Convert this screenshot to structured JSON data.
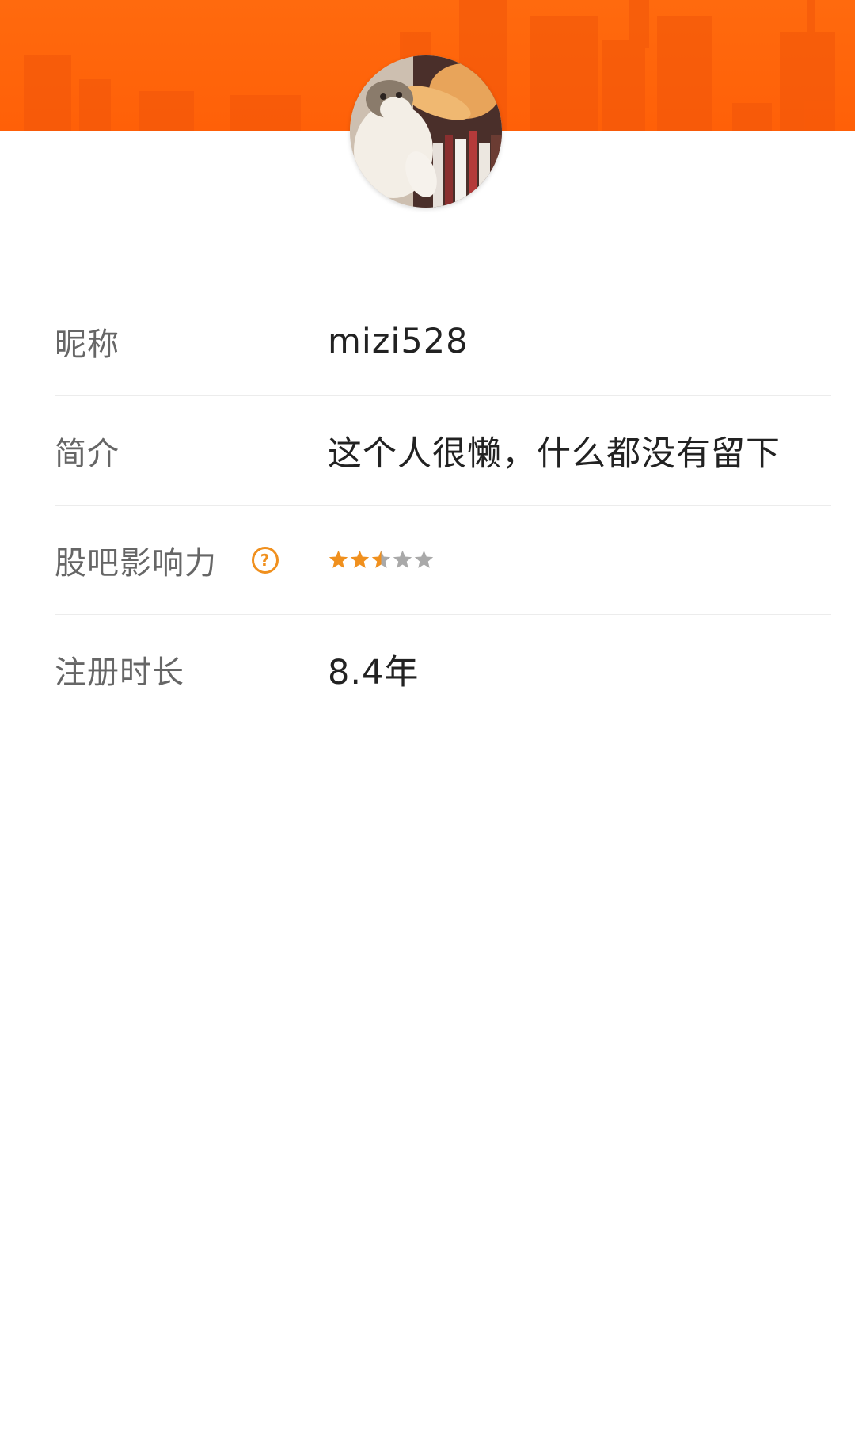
{
  "profile": {
    "rows": [
      {
        "label": "昵称",
        "value": "mizi528"
      },
      {
        "label": "简介",
        "value": "这个人很懒，什么都没有留下"
      },
      {
        "label": "股吧影响力",
        "help_icon": "question-circle-icon",
        "rating": 2.5,
        "rating_max": 5
      },
      {
        "label": "注册时长",
        "value": "8.4年"
      }
    ]
  },
  "colors": {
    "banner": "#ff6a0e",
    "star_filled": "#f0901e",
    "star_empty": "#a9a9a9",
    "label_text": "#666666",
    "value_text": "#222222"
  },
  "icons": {
    "avatar": "cat-photo-avatar",
    "help": "question-circle-icon",
    "star": "star-icon"
  }
}
